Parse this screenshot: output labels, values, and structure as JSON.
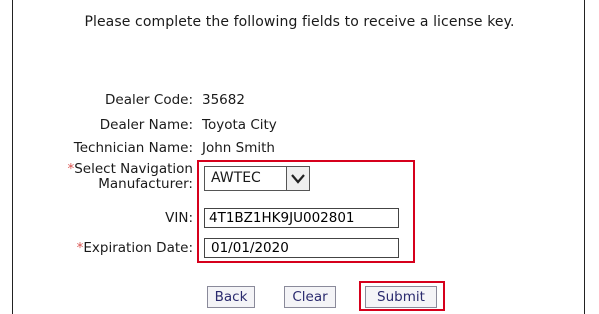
{
  "instructions": "Please complete the following fields to receive a license key.",
  "fields": {
    "dealer_code": {
      "label": "Dealer Code:",
      "value": "35682"
    },
    "dealer_name": {
      "label": "Dealer Name:",
      "value": "Toyota City"
    },
    "technician_name": {
      "label": "Technician Name:",
      "value": "John Smith"
    },
    "nav_manufacturer": {
      "required_mark": "*",
      "label_line1": "Select Navigation",
      "label_line2": "Manufacturer:",
      "selected": "AWTEC"
    },
    "vin": {
      "label": "VIN:",
      "value": "4T1BZ1HK9JU002801"
    },
    "expiration_date": {
      "required_mark": "*",
      "label": "Expiration Date:",
      "value": "01/01/2020"
    }
  },
  "buttons": {
    "back": "Back",
    "clear": "Clear",
    "submit": "Submit"
  },
  "colors": {
    "highlight": "#d6001c",
    "required": "#d9534f",
    "button_text": "#2a2a6e"
  },
  "icons": {
    "dropdown": "chevron-down-icon"
  }
}
